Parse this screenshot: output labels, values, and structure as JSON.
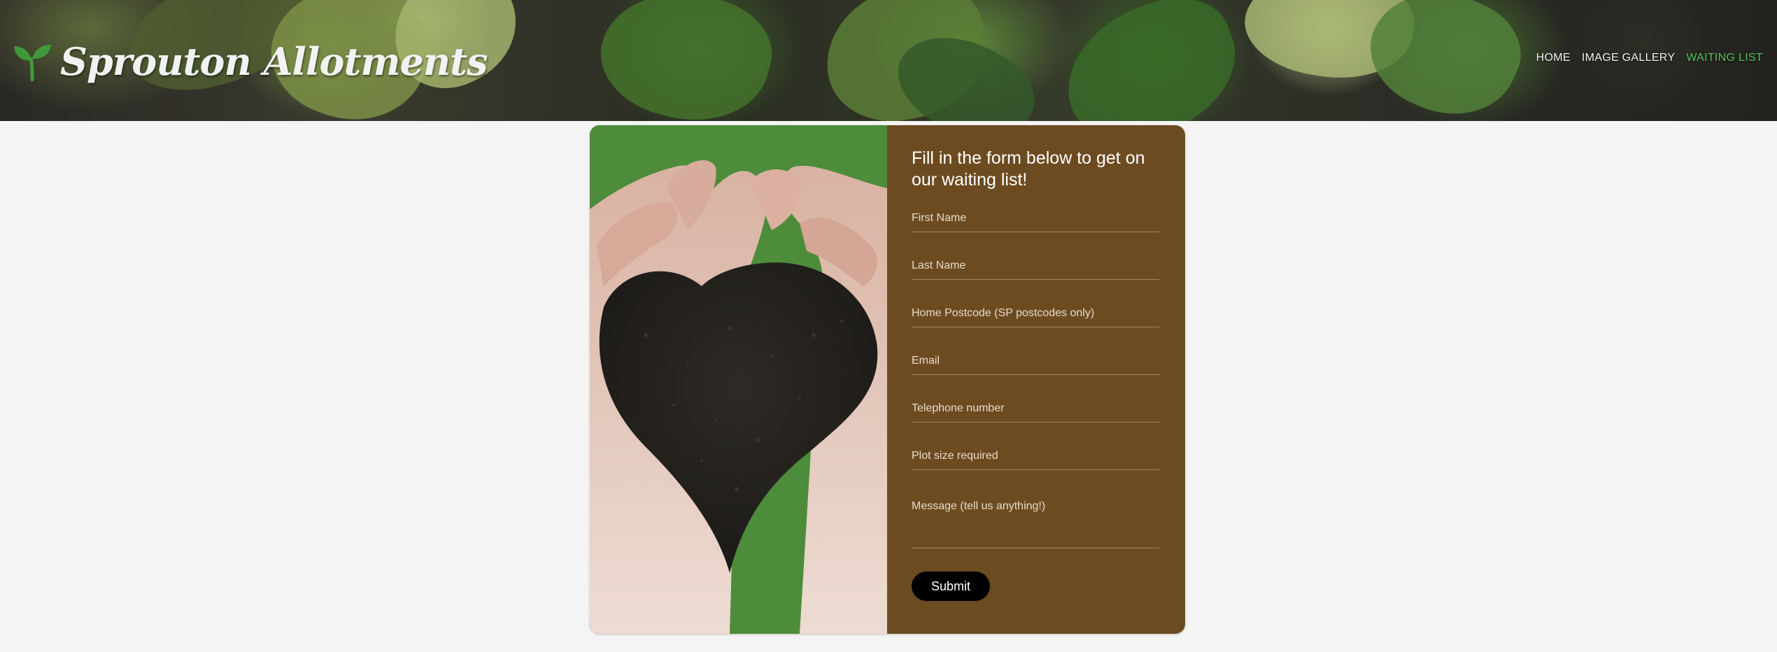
{
  "site": {
    "title": "Sprouton Allotments",
    "logo_icon": "sprout-icon",
    "brand_color": "#3f9a3a"
  },
  "nav": {
    "items": [
      {
        "label": "HOME",
        "active": false
      },
      {
        "label": "IMAGE GALLERY",
        "active": false
      },
      {
        "label": "WAITING LIST",
        "active": true
      }
    ],
    "active_color": "#56c45c"
  },
  "form": {
    "heading": "Fill in the form below to get on our waiting list!",
    "fields": {
      "first_name": {
        "value": "",
        "placeholder": "First Name"
      },
      "last_name": {
        "value": "",
        "placeholder": "Last Name"
      },
      "postcode": {
        "value": "",
        "placeholder": "Home Postcode (SP postcodes only)"
      },
      "email": {
        "value": "",
        "placeholder": "Email"
      },
      "telephone": {
        "value": "",
        "placeholder": "Telephone number"
      },
      "plot_size": {
        "value": "",
        "placeholder": "Plot size required"
      },
      "message": {
        "value": "",
        "placeholder": "Message (tell us anything!)"
      }
    },
    "submit_label": "Submit",
    "panel_color": "#6d4b20"
  }
}
